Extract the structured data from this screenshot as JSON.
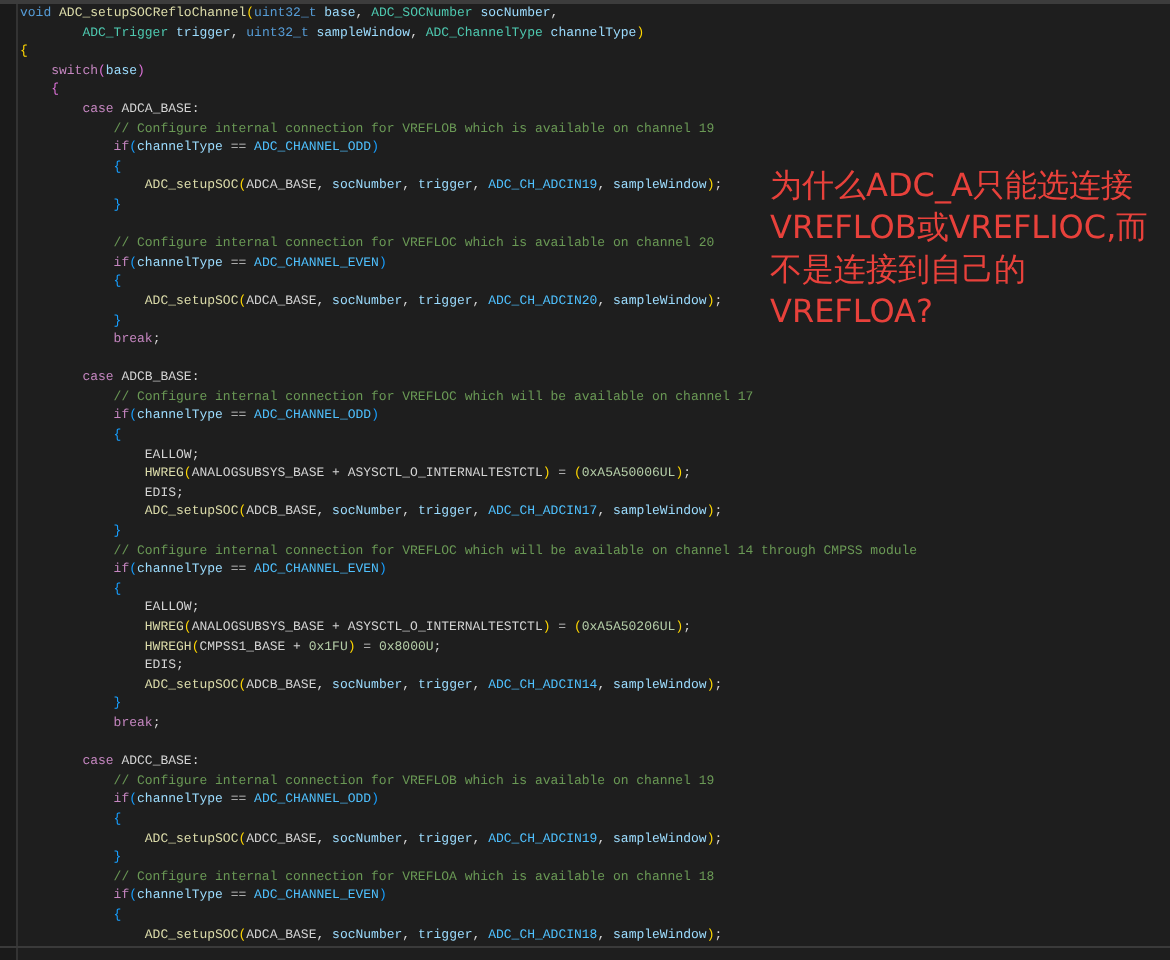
{
  "editor": {
    "lines": [
      {
        "kind": "code",
        "tokens": [
          {
            "text": "void ",
            "kind": "st"
          },
          {
            "text": "ADC_setupSOCRefloChannel",
            "kind": "fn"
          },
          {
            "text": "(",
            "kind": "b1"
          },
          {
            "text": "uint32_t ",
            "kind": "st"
          },
          {
            "text": "base",
            "kind": "va"
          },
          {
            "text": ", ",
            "kind": "pl"
          },
          {
            "text": "ADC_SOCNumber ",
            "kind": "ty"
          },
          {
            "text": "socNumber",
            "kind": "va"
          },
          {
            "text": ",",
            "kind": "pl"
          }
        ]
      },
      {
        "kind": "code",
        "tokens": [
          {
            "text": "        ADC_Trigger ",
            "kind": "ty"
          },
          {
            "text": "trigger",
            "kind": "va"
          },
          {
            "text": ", ",
            "kind": "pl"
          },
          {
            "text": "uint32_t ",
            "kind": "st"
          },
          {
            "text": "sampleWindow",
            "kind": "va"
          },
          {
            "text": ", ",
            "kind": "pl"
          },
          {
            "text": "ADC_ChannelType ",
            "kind": "ty"
          },
          {
            "text": "channelType",
            "kind": "va"
          },
          {
            "text": ")",
            "kind": "b1"
          }
        ]
      },
      {
        "kind": "code",
        "tokens": [
          {
            "text": "{",
            "kind": "b1"
          }
        ]
      },
      {
        "kind": "code",
        "tokens": [
          {
            "text": "    switch",
            "kind": "kw"
          },
          {
            "text": "(",
            "kind": "b2"
          },
          {
            "text": "base",
            "kind": "va"
          },
          {
            "text": ")",
            "kind": "b2"
          }
        ]
      },
      {
        "kind": "code",
        "tokens": [
          {
            "text": "    {",
            "kind": "b2"
          }
        ]
      },
      {
        "kind": "code",
        "tokens": [
          {
            "text": "        case ",
            "kind": "kw"
          },
          {
            "text": "ADCA_BASE:",
            "kind": "pl"
          }
        ]
      },
      {
        "kind": "code",
        "tokens": [
          {
            "text": "            // Configure internal connection for VREFLOB which is available on channel 19",
            "kind": "cm"
          }
        ]
      },
      {
        "kind": "code",
        "tokens": [
          {
            "text": "            if",
            "kind": "kw"
          },
          {
            "text": "(",
            "kind": "b3"
          },
          {
            "text": "channelType",
            "kind": "va"
          },
          {
            "text": " == ",
            "kind": "pl"
          },
          {
            "text": "ADC_CHANNEL_ODD",
            "kind": "co"
          },
          {
            "text": ")",
            "kind": "b3"
          }
        ]
      },
      {
        "kind": "code",
        "tokens": [
          {
            "text": "            {",
            "kind": "b3"
          }
        ]
      },
      {
        "kind": "code",
        "tokens": [
          {
            "text": "                ADC_setupSOC",
            "kind": "fn"
          },
          {
            "text": "(",
            "kind": "b1"
          },
          {
            "text": "ADCA_BASE, ",
            "kind": "pl"
          },
          {
            "text": "socNumber",
            "kind": "va"
          },
          {
            "text": ", ",
            "kind": "pl"
          },
          {
            "text": "trigger",
            "kind": "va"
          },
          {
            "text": ", ",
            "kind": "pl"
          },
          {
            "text": "ADC_CH_ADCIN19",
            "kind": "co"
          },
          {
            "text": ", ",
            "kind": "pl"
          },
          {
            "text": "sampleWindow",
            "kind": "va"
          },
          {
            "text": ")",
            "kind": "b1"
          },
          {
            "text": ";",
            "kind": "pl"
          }
        ]
      },
      {
        "kind": "code",
        "tokens": [
          {
            "text": "            }",
            "kind": "b3"
          }
        ]
      },
      {
        "kind": "blank"
      },
      {
        "kind": "code",
        "tokens": [
          {
            "text": "            // Configure internal connection for VREFLOC which is available on channel 20",
            "kind": "cm"
          }
        ]
      },
      {
        "kind": "code",
        "tokens": [
          {
            "text": "            if",
            "kind": "kw"
          },
          {
            "text": "(",
            "kind": "b3"
          },
          {
            "text": "channelType",
            "kind": "va"
          },
          {
            "text": " == ",
            "kind": "pl"
          },
          {
            "text": "ADC_CHANNEL_EVEN",
            "kind": "co"
          },
          {
            "text": ")",
            "kind": "b3"
          }
        ]
      },
      {
        "kind": "code",
        "tokens": [
          {
            "text": "            {",
            "kind": "b3"
          }
        ]
      },
      {
        "kind": "code",
        "tokens": [
          {
            "text": "                ADC_setupSOC",
            "kind": "fn"
          },
          {
            "text": "(",
            "kind": "b1"
          },
          {
            "text": "ADCA_BASE, ",
            "kind": "pl"
          },
          {
            "text": "socNumber",
            "kind": "va"
          },
          {
            "text": ", ",
            "kind": "pl"
          },
          {
            "text": "trigger",
            "kind": "va"
          },
          {
            "text": ", ",
            "kind": "pl"
          },
          {
            "text": "ADC_CH_ADCIN20",
            "kind": "co"
          },
          {
            "text": ", ",
            "kind": "pl"
          },
          {
            "text": "sampleWindow",
            "kind": "va"
          },
          {
            "text": ")",
            "kind": "b1"
          },
          {
            "text": ";",
            "kind": "pl"
          }
        ]
      },
      {
        "kind": "code",
        "tokens": [
          {
            "text": "            }",
            "kind": "b3"
          }
        ]
      },
      {
        "kind": "code",
        "tokens": [
          {
            "text": "            break",
            "kind": "kw"
          },
          {
            "text": ";",
            "kind": "pl"
          }
        ]
      },
      {
        "kind": "blank"
      },
      {
        "kind": "code",
        "tokens": [
          {
            "text": "        case ",
            "kind": "kw"
          },
          {
            "text": "ADCB_BASE:",
            "kind": "pl"
          }
        ]
      },
      {
        "kind": "code",
        "tokens": [
          {
            "text": "            // Configure internal connection for VREFLOC which will be available on channel 17",
            "kind": "cm"
          }
        ]
      },
      {
        "kind": "code",
        "tokens": [
          {
            "text": "            if",
            "kind": "kw"
          },
          {
            "text": "(",
            "kind": "b3"
          },
          {
            "text": "channelType",
            "kind": "va"
          },
          {
            "text": " == ",
            "kind": "pl"
          },
          {
            "text": "ADC_CHANNEL_ODD",
            "kind": "co"
          },
          {
            "text": ")",
            "kind": "b3"
          }
        ]
      },
      {
        "kind": "code",
        "tokens": [
          {
            "text": "            {",
            "kind": "b3"
          }
        ]
      },
      {
        "kind": "code",
        "tokens": [
          {
            "text": "                EALLOW;",
            "kind": "pl"
          }
        ]
      },
      {
        "kind": "code",
        "tokens": [
          {
            "text": "                HWREG",
            "kind": "fn"
          },
          {
            "text": "(",
            "kind": "b1"
          },
          {
            "text": "ANALOGSUBSYS_BASE + ASYSCTL_O_INTERNALTESTCTL",
            "kind": "pl"
          },
          {
            "text": ")",
            "kind": "b1"
          },
          {
            "text": " = ",
            "kind": "pl"
          },
          {
            "text": "(",
            "kind": "b1"
          },
          {
            "text": "0xA5A50006UL",
            "kind": "nu"
          },
          {
            "text": ")",
            "kind": "b1"
          },
          {
            "text": ";",
            "kind": "pl"
          }
        ]
      },
      {
        "kind": "code",
        "tokens": [
          {
            "text": "                EDIS;",
            "kind": "pl"
          }
        ]
      },
      {
        "kind": "code",
        "tokens": [
          {
            "text": "                ADC_setupSOC",
            "kind": "fn"
          },
          {
            "text": "(",
            "kind": "b1"
          },
          {
            "text": "ADCB_BASE, ",
            "kind": "pl"
          },
          {
            "text": "socNumber",
            "kind": "va"
          },
          {
            "text": ", ",
            "kind": "pl"
          },
          {
            "text": "trigger",
            "kind": "va"
          },
          {
            "text": ", ",
            "kind": "pl"
          },
          {
            "text": "ADC_CH_ADCIN17",
            "kind": "co"
          },
          {
            "text": ", ",
            "kind": "pl"
          },
          {
            "text": "sampleWindow",
            "kind": "va"
          },
          {
            "text": ")",
            "kind": "b1"
          },
          {
            "text": ";",
            "kind": "pl"
          }
        ]
      },
      {
        "kind": "code",
        "tokens": [
          {
            "text": "            }",
            "kind": "b3"
          }
        ]
      },
      {
        "kind": "code",
        "tokens": [
          {
            "text": "            // Configure internal connection for VREFLOC which will be available on channel 14 through CMPSS module",
            "kind": "cm"
          }
        ]
      },
      {
        "kind": "code",
        "tokens": [
          {
            "text": "            if",
            "kind": "kw"
          },
          {
            "text": "(",
            "kind": "b3"
          },
          {
            "text": "channelType",
            "kind": "va"
          },
          {
            "text": " == ",
            "kind": "pl"
          },
          {
            "text": "ADC_CHANNEL_EVEN",
            "kind": "co"
          },
          {
            "text": ")",
            "kind": "b3"
          }
        ]
      },
      {
        "kind": "code",
        "tokens": [
          {
            "text": "            {",
            "kind": "b3"
          }
        ]
      },
      {
        "kind": "code",
        "tokens": [
          {
            "text": "                EALLOW;",
            "kind": "pl"
          }
        ]
      },
      {
        "kind": "code",
        "tokens": [
          {
            "text": "                HWREG",
            "kind": "fn"
          },
          {
            "text": "(",
            "kind": "b1"
          },
          {
            "text": "ANALOGSUBSYS_BASE + ASYSCTL_O_INTERNALTESTCTL",
            "kind": "pl"
          },
          {
            "text": ")",
            "kind": "b1"
          },
          {
            "text": " = ",
            "kind": "pl"
          },
          {
            "text": "(",
            "kind": "b1"
          },
          {
            "text": "0xA5A50206UL",
            "kind": "nu"
          },
          {
            "text": ")",
            "kind": "b1"
          },
          {
            "text": ";",
            "kind": "pl"
          }
        ]
      },
      {
        "kind": "code",
        "tokens": [
          {
            "text": "                HWREGH",
            "kind": "fn"
          },
          {
            "text": "(",
            "kind": "b1"
          },
          {
            "text": "CMPSS1_BASE + ",
            "kind": "pl"
          },
          {
            "text": "0x1FU",
            "kind": "nu"
          },
          {
            "text": ")",
            "kind": "b1"
          },
          {
            "text": " = ",
            "kind": "pl"
          },
          {
            "text": "0x8000U",
            "kind": "nu"
          },
          {
            "text": ";",
            "kind": "pl"
          }
        ]
      },
      {
        "kind": "code",
        "tokens": [
          {
            "text": "                EDIS;",
            "kind": "pl"
          }
        ]
      },
      {
        "kind": "code",
        "tokens": [
          {
            "text": "                ADC_setupSOC",
            "kind": "fn"
          },
          {
            "text": "(",
            "kind": "b1"
          },
          {
            "text": "ADCB_BASE, ",
            "kind": "pl"
          },
          {
            "text": "socNumber",
            "kind": "va"
          },
          {
            "text": ", ",
            "kind": "pl"
          },
          {
            "text": "trigger",
            "kind": "va"
          },
          {
            "text": ", ",
            "kind": "pl"
          },
          {
            "text": "ADC_CH_ADCIN14",
            "kind": "co"
          },
          {
            "text": ", ",
            "kind": "pl"
          },
          {
            "text": "sampleWindow",
            "kind": "va"
          },
          {
            "text": ")",
            "kind": "b1"
          },
          {
            "text": ";",
            "kind": "pl"
          }
        ]
      },
      {
        "kind": "code",
        "tokens": [
          {
            "text": "            }",
            "kind": "b3"
          }
        ]
      },
      {
        "kind": "code",
        "tokens": [
          {
            "text": "            break",
            "kind": "kw"
          },
          {
            "text": ";",
            "kind": "pl"
          }
        ]
      },
      {
        "kind": "blank"
      },
      {
        "kind": "code",
        "tokens": [
          {
            "text": "        case ",
            "kind": "kw"
          },
          {
            "text": "ADCC_BASE:",
            "kind": "pl"
          }
        ]
      },
      {
        "kind": "code",
        "tokens": [
          {
            "text": "            // Configure internal connection for VREFLOB which is available on channel 19",
            "kind": "cm"
          }
        ]
      },
      {
        "kind": "code",
        "tokens": [
          {
            "text": "            if",
            "kind": "kw"
          },
          {
            "text": "(",
            "kind": "b3"
          },
          {
            "text": "channelType",
            "kind": "va"
          },
          {
            "text": " == ",
            "kind": "pl"
          },
          {
            "text": "ADC_CHANNEL_ODD",
            "kind": "co"
          },
          {
            "text": ")",
            "kind": "b3"
          }
        ]
      },
      {
        "kind": "code",
        "tokens": [
          {
            "text": "            {",
            "kind": "b3"
          }
        ]
      },
      {
        "kind": "code",
        "tokens": [
          {
            "text": "                ADC_setupSOC",
            "kind": "fn"
          },
          {
            "text": "(",
            "kind": "b1"
          },
          {
            "text": "ADCC_BASE, ",
            "kind": "pl"
          },
          {
            "text": "socNumber",
            "kind": "va"
          },
          {
            "text": ", ",
            "kind": "pl"
          },
          {
            "text": "trigger",
            "kind": "va"
          },
          {
            "text": ", ",
            "kind": "pl"
          },
          {
            "text": "ADC_CH_ADCIN19",
            "kind": "co"
          },
          {
            "text": ", ",
            "kind": "pl"
          },
          {
            "text": "sampleWindow",
            "kind": "va"
          },
          {
            "text": ")",
            "kind": "b1"
          },
          {
            "text": ";",
            "kind": "pl"
          }
        ]
      },
      {
        "kind": "code",
        "tokens": [
          {
            "text": "            }",
            "kind": "b3"
          }
        ]
      },
      {
        "kind": "code",
        "tokens": [
          {
            "text": "            // Configure internal connection for VREFLOA which is available on channel 18",
            "kind": "cm"
          }
        ]
      },
      {
        "kind": "code",
        "tokens": [
          {
            "text": "            if",
            "kind": "kw"
          },
          {
            "text": "(",
            "kind": "b3"
          },
          {
            "text": "channelType",
            "kind": "va"
          },
          {
            "text": " == ",
            "kind": "pl"
          },
          {
            "text": "ADC_CHANNEL_EVEN",
            "kind": "co"
          },
          {
            "text": ")",
            "kind": "b3"
          }
        ]
      },
      {
        "kind": "code",
        "tokens": [
          {
            "text": "            {",
            "kind": "b3"
          }
        ]
      },
      {
        "kind": "code",
        "tokens": [
          {
            "text": "                ADC_setupSOC",
            "kind": "fn"
          },
          {
            "text": "(",
            "kind": "b1"
          },
          {
            "text": "ADCA_BASE, ",
            "kind": "pl"
          },
          {
            "text": "socNumber",
            "kind": "va"
          },
          {
            "text": ", ",
            "kind": "pl"
          },
          {
            "text": "trigger",
            "kind": "va"
          },
          {
            "text": ", ",
            "kind": "pl"
          },
          {
            "text": "ADC_CH_ADCIN18",
            "kind": "co"
          },
          {
            "text": ", ",
            "kind": "pl"
          },
          {
            "text": "sampleWindow",
            "kind": "va"
          },
          {
            "text": ")",
            "kind": "b1"
          },
          {
            "text": ";",
            "kind": "pl"
          }
        ]
      }
    ]
  },
  "annotation": {
    "lines": [
      "为什么ADC_A只能选连接",
      "VREFLOB或VREFLIOC,而",
      "不是连接到自己的",
      "VREFLOA?"
    ]
  }
}
